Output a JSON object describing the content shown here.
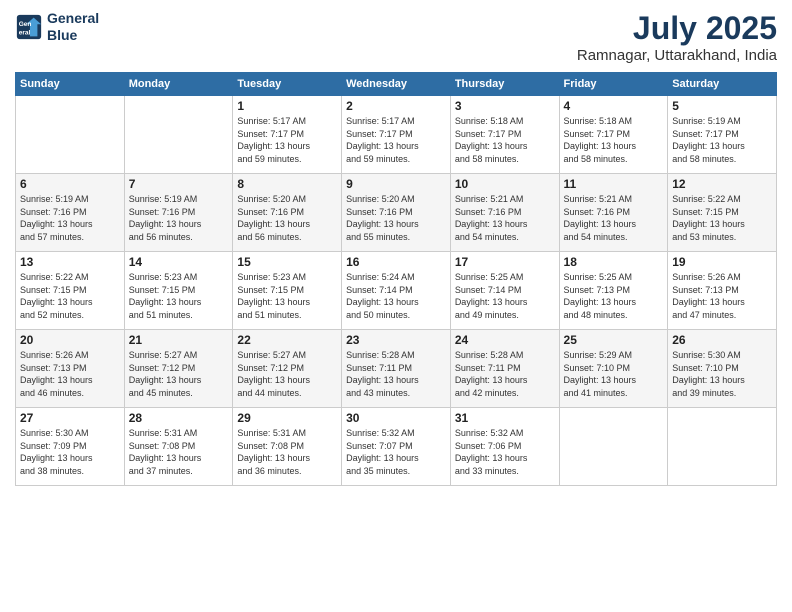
{
  "logo": {
    "line1": "General",
    "line2": "Blue"
  },
  "title": {
    "month_year": "July 2025",
    "location": "Ramnagar, Uttarakhand, India"
  },
  "weekdays": [
    "Sunday",
    "Monday",
    "Tuesday",
    "Wednesday",
    "Thursday",
    "Friday",
    "Saturday"
  ],
  "weeks": [
    [
      {
        "day": "",
        "info": ""
      },
      {
        "day": "",
        "info": ""
      },
      {
        "day": "1",
        "info": "Sunrise: 5:17 AM\nSunset: 7:17 PM\nDaylight: 13 hours\nand 59 minutes."
      },
      {
        "day": "2",
        "info": "Sunrise: 5:17 AM\nSunset: 7:17 PM\nDaylight: 13 hours\nand 59 minutes."
      },
      {
        "day": "3",
        "info": "Sunrise: 5:18 AM\nSunset: 7:17 PM\nDaylight: 13 hours\nand 58 minutes."
      },
      {
        "day": "4",
        "info": "Sunrise: 5:18 AM\nSunset: 7:17 PM\nDaylight: 13 hours\nand 58 minutes."
      },
      {
        "day": "5",
        "info": "Sunrise: 5:19 AM\nSunset: 7:17 PM\nDaylight: 13 hours\nand 58 minutes."
      }
    ],
    [
      {
        "day": "6",
        "info": "Sunrise: 5:19 AM\nSunset: 7:16 PM\nDaylight: 13 hours\nand 57 minutes."
      },
      {
        "day": "7",
        "info": "Sunrise: 5:19 AM\nSunset: 7:16 PM\nDaylight: 13 hours\nand 56 minutes."
      },
      {
        "day": "8",
        "info": "Sunrise: 5:20 AM\nSunset: 7:16 PM\nDaylight: 13 hours\nand 56 minutes."
      },
      {
        "day": "9",
        "info": "Sunrise: 5:20 AM\nSunset: 7:16 PM\nDaylight: 13 hours\nand 55 minutes."
      },
      {
        "day": "10",
        "info": "Sunrise: 5:21 AM\nSunset: 7:16 PM\nDaylight: 13 hours\nand 54 minutes."
      },
      {
        "day": "11",
        "info": "Sunrise: 5:21 AM\nSunset: 7:16 PM\nDaylight: 13 hours\nand 54 minutes."
      },
      {
        "day": "12",
        "info": "Sunrise: 5:22 AM\nSunset: 7:15 PM\nDaylight: 13 hours\nand 53 minutes."
      }
    ],
    [
      {
        "day": "13",
        "info": "Sunrise: 5:22 AM\nSunset: 7:15 PM\nDaylight: 13 hours\nand 52 minutes."
      },
      {
        "day": "14",
        "info": "Sunrise: 5:23 AM\nSunset: 7:15 PM\nDaylight: 13 hours\nand 51 minutes."
      },
      {
        "day": "15",
        "info": "Sunrise: 5:23 AM\nSunset: 7:15 PM\nDaylight: 13 hours\nand 51 minutes."
      },
      {
        "day": "16",
        "info": "Sunrise: 5:24 AM\nSunset: 7:14 PM\nDaylight: 13 hours\nand 50 minutes."
      },
      {
        "day": "17",
        "info": "Sunrise: 5:25 AM\nSunset: 7:14 PM\nDaylight: 13 hours\nand 49 minutes."
      },
      {
        "day": "18",
        "info": "Sunrise: 5:25 AM\nSunset: 7:13 PM\nDaylight: 13 hours\nand 48 minutes."
      },
      {
        "day": "19",
        "info": "Sunrise: 5:26 AM\nSunset: 7:13 PM\nDaylight: 13 hours\nand 47 minutes."
      }
    ],
    [
      {
        "day": "20",
        "info": "Sunrise: 5:26 AM\nSunset: 7:13 PM\nDaylight: 13 hours\nand 46 minutes."
      },
      {
        "day": "21",
        "info": "Sunrise: 5:27 AM\nSunset: 7:12 PM\nDaylight: 13 hours\nand 45 minutes."
      },
      {
        "day": "22",
        "info": "Sunrise: 5:27 AM\nSunset: 7:12 PM\nDaylight: 13 hours\nand 44 minutes."
      },
      {
        "day": "23",
        "info": "Sunrise: 5:28 AM\nSunset: 7:11 PM\nDaylight: 13 hours\nand 43 minutes."
      },
      {
        "day": "24",
        "info": "Sunrise: 5:28 AM\nSunset: 7:11 PM\nDaylight: 13 hours\nand 42 minutes."
      },
      {
        "day": "25",
        "info": "Sunrise: 5:29 AM\nSunset: 7:10 PM\nDaylight: 13 hours\nand 41 minutes."
      },
      {
        "day": "26",
        "info": "Sunrise: 5:30 AM\nSunset: 7:10 PM\nDaylight: 13 hours\nand 39 minutes."
      }
    ],
    [
      {
        "day": "27",
        "info": "Sunrise: 5:30 AM\nSunset: 7:09 PM\nDaylight: 13 hours\nand 38 minutes."
      },
      {
        "day": "28",
        "info": "Sunrise: 5:31 AM\nSunset: 7:08 PM\nDaylight: 13 hours\nand 37 minutes."
      },
      {
        "day": "29",
        "info": "Sunrise: 5:31 AM\nSunset: 7:08 PM\nDaylight: 13 hours\nand 36 minutes."
      },
      {
        "day": "30",
        "info": "Sunrise: 5:32 AM\nSunset: 7:07 PM\nDaylight: 13 hours\nand 35 minutes."
      },
      {
        "day": "31",
        "info": "Sunrise: 5:32 AM\nSunset: 7:06 PM\nDaylight: 13 hours\nand 33 minutes."
      },
      {
        "day": "",
        "info": ""
      },
      {
        "day": "",
        "info": ""
      }
    ]
  ]
}
